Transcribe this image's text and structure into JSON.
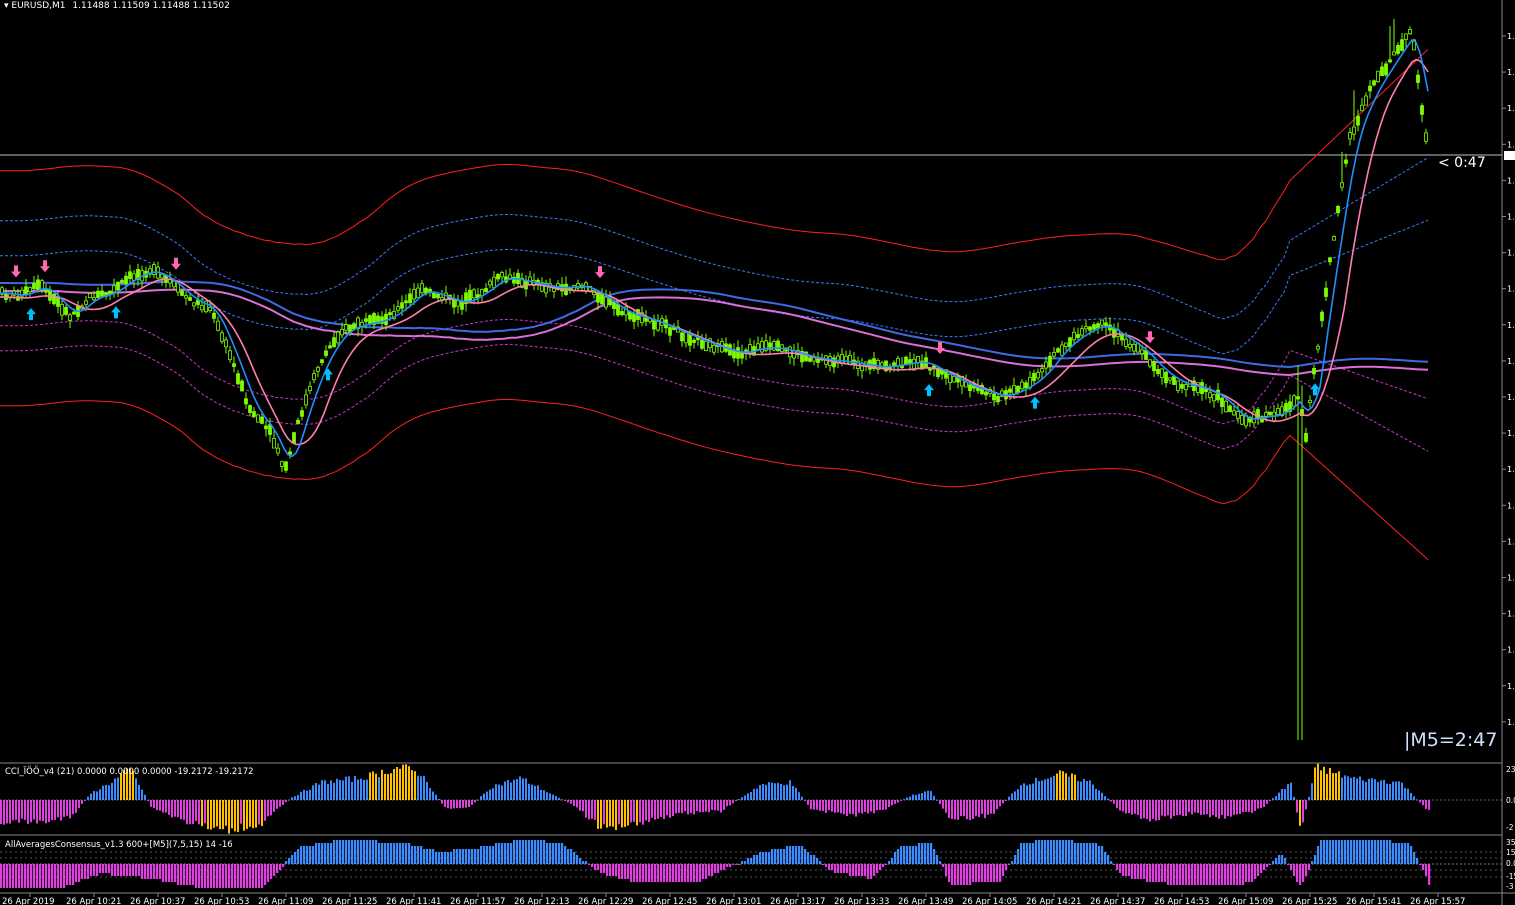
{
  "window": {
    "symbol_label": "EURUSD,M1",
    "ohlc_label": "1.11488 1.11509 1.11488 1.11502",
    "countdown": "< 0:47",
    "timer_m5": "|M5=2:47"
  },
  "indicators": {
    "cci_label": "CCI_ÏÖÖ_v4 (21) 0.0000 0.0000 0.0000 -19.2172 -19.2172",
    "cci_scale": [
      "23",
      "0.0",
      "-2"
    ],
    "consensus_label": "AllAveragesConsensus_v1.3 600+[M5](7,5,15) 14 -16",
    "consensus_scale": [
      "35",
      "15",
      "0.0",
      "-15",
      "-3"
    ]
  },
  "colors": {
    "background": "#000000",
    "candle": "#7CFC00",
    "ma_fast": "#1E90FF",
    "ma_slow": "#FF7FAF",
    "ma_long_blue": "#4169E1",
    "ma_long_magenta": "#DA70D6",
    "band_outer": "#FF2020",
    "band_inner": "#3A7CFF",
    "band_inner_low": "#CC33CC",
    "arrow_up": "#00BFFF",
    "arrow_down": "#FF69B4",
    "hist_blue": "#3C8CFF",
    "hist_magenta": "#E040E0",
    "hist_gold": "#FFC000"
  },
  "chart_data": {
    "type": "candlestick",
    "symbol": "EURUSD",
    "timeframe": "M1",
    "x_tick_labels": [
      "26 Apr 2019",
      "26 Apr 10:21",
      "26 Apr 10:37",
      "26 Apr 10:53",
      "26 Apr 11:09",
      "26 Apr 11:25",
      "26 Apr 11:41",
      "26 Apr 11:57",
      "26 Apr 12:13",
      "26 Apr 12:29",
      "26 Apr 12:45",
      "26 Apr 13:01",
      "26 Apr 13:17",
      "26 Apr 13:33",
      "26 Apr 13:49",
      "26 Apr 14:05",
      "26 Apr 14:21",
      "26 Apr 14:37",
      "26 Apr 14:53",
      "26 Apr 15:09",
      "26 Apr 15:25",
      "26 Apr 15:41",
      "26 Apr 15:57"
    ],
    "y_tick_labels": [
      "1.",
      "1.",
      "1.",
      "1.",
      "1.",
      "1.",
      "1.",
      "1.",
      "1.",
      "1.",
      "1.",
      "1.",
      "1.",
      "1.",
      "1.",
      "1.",
      "1.",
      "1.",
      "1.",
      "1."
    ],
    "price_path": [
      [
        0,
        60
      ],
      [
        20,
        62
      ],
      [
        40,
        55
      ],
      [
        60,
        68
      ],
      [
        70,
        75
      ],
      [
        90,
        63
      ],
      [
        110,
        60
      ],
      [
        130,
        50
      ],
      [
        150,
        45
      ],
      [
        170,
        53
      ],
      [
        190,
        65
      ],
      [
        210,
        70
      ],
      [
        230,
        100
      ],
      [
        250,
        135
      ],
      [
        270,
        150
      ],
      [
        285,
        175
      ],
      [
        300,
        140
      ],
      [
        320,
        105
      ],
      [
        340,
        85
      ],
      [
        360,
        80
      ],
      [
        380,
        78
      ],
      [
        400,
        70
      ],
      [
        420,
        58
      ],
      [
        440,
        62
      ],
      [
        460,
        67
      ],
      [
        480,
        60
      ],
      [
        500,
        50
      ],
      [
        520,
        52
      ],
      [
        540,
        55
      ],
      [
        560,
        57
      ],
      [
        580,
        55
      ],
      [
        600,
        62
      ],
      [
        620,
        72
      ],
      [
        640,
        76
      ],
      [
        660,
        80
      ],
      [
        680,
        86
      ],
      [
        700,
        91
      ],
      [
        720,
        96
      ],
      [
        740,
        99
      ],
      [
        760,
        95
      ],
      [
        780,
        96
      ],
      [
        800,
        100
      ],
      [
        820,
        103
      ],
      [
        840,
        104
      ],
      [
        860,
        106
      ],
      [
        880,
        108
      ],
      [
        900,
        106
      ],
      [
        920,
        104
      ],
      [
        940,
        111
      ],
      [
        960,
        118
      ],
      [
        980,
        123
      ],
      [
        1000,
        127
      ],
      [
        1020,
        122
      ],
      [
        1040,
        113
      ],
      [
        1060,
        96
      ],
      [
        1080,
        86
      ],
      [
        1100,
        80
      ],
      [
        1120,
        88
      ],
      [
        1140,
        97
      ],
      [
        1160,
        111
      ],
      [
        1180,
        119
      ],
      [
        1200,
        121
      ],
      [
        1220,
        128
      ],
      [
        1240,
        142
      ],
      [
        1260,
        140
      ],
      [
        1280,
        138
      ],
      [
        1300,
        125
      ],
      [
        1305,
        160
      ],
      [
        1312,
        120
      ],
      [
        1330,
        40
      ],
      [
        1350,
        -40
      ],
      [
        1370,
        -70
      ],
      [
        1390,
        -90
      ],
      [
        1400,
        -100
      ],
      [
        1412,
        -110
      ],
      [
        1425,
        -40
      ]
    ],
    "spike_low_at": 1300,
    "signals_up": [
      31,
      116,
      328,
      929,
      1035,
      1315
    ],
    "signals_down": [
      16,
      45,
      176,
      600,
      940,
      1150
    ],
    "cci_hist": [
      [
        0,
        -1
      ],
      [
        40,
        -1
      ],
      [
        70,
        -0.8
      ],
      [
        90,
        0.3
      ],
      [
        110,
        0.8
      ],
      [
        130,
        1.4
      ],
      [
        150,
        -0.3
      ],
      [
        180,
        -0.9
      ],
      [
        220,
        -1.4
      ],
      [
        260,
        -1.1
      ],
      [
        290,
        0.1
      ],
      [
        320,
        0.8
      ],
      [
        360,
        1.0
      ],
      [
        400,
        1.5
      ],
      [
        420,
        1.2
      ],
      [
        445,
        -0.4
      ],
      [
        470,
        -0.3
      ],
      [
        490,
        0.6
      ],
      [
        520,
        1.0
      ],
      [
        545,
        0.4
      ],
      [
        575,
        -0.3
      ],
      [
        600,
        -1.3
      ],
      [
        640,
        -1.0
      ],
      [
        680,
        -0.6
      ],
      [
        720,
        -0.5
      ],
      [
        760,
        0.7
      ],
      [
        790,
        0.8
      ],
      [
        810,
        -0.4
      ],
      [
        850,
        -0.7
      ],
      [
        880,
        -0.5
      ],
      [
        910,
        0.2
      ],
      [
        930,
        0.4
      ],
      [
        950,
        -0.9
      ],
      [
        990,
        -0.7
      ],
      [
        1020,
        0.7
      ],
      [
        1060,
        1.2
      ],
      [
        1090,
        0.8
      ],
      [
        1120,
        -0.5
      ],
      [
        1150,
        -0.9
      ],
      [
        1190,
        -0.6
      ],
      [
        1230,
        -0.8
      ],
      [
        1260,
        -0.4
      ],
      [
        1290,
        0.8
      ],
      [
        1300,
        -1.4
      ],
      [
        1315,
        1.5
      ],
      [
        1350,
        1.0
      ],
      [
        1400,
        0.8
      ],
      [
        1425,
        -0.4
      ]
    ],
    "consensus_hist": [
      [
        0,
        -1
      ],
      [
        60,
        -1
      ],
      [
        100,
        -0.4
      ],
      [
        150,
        -0.6
      ],
      [
        200,
        -1
      ],
      [
        260,
        -1
      ],
      [
        300,
        0.7
      ],
      [
        340,
        1
      ],
      [
        400,
        0.9
      ],
      [
        440,
        0.5
      ],
      [
        480,
        0.7
      ],
      [
        520,
        1
      ],
      [
        560,
        0.9
      ],
      [
        600,
        -0.4
      ],
      [
        640,
        -0.8
      ],
      [
        700,
        -0.7
      ],
      [
        760,
        0.5
      ],
      [
        800,
        0.8
      ],
      [
        830,
        -0.3
      ],
      [
        870,
        -0.6
      ],
      [
        900,
        0.7
      ],
      [
        930,
        0.9
      ],
      [
        950,
        -0.9
      ],
      [
        1000,
        -0.7
      ],
      [
        1020,
        0.9
      ],
      [
        1060,
        1
      ],
      [
        1100,
        0.8
      ],
      [
        1120,
        -0.5
      ],
      [
        1160,
        -0.8
      ],
      [
        1200,
        -0.9
      ],
      [
        1250,
        -0.8
      ],
      [
        1280,
        0.5
      ],
      [
        1300,
        -1
      ],
      [
        1320,
        1
      ],
      [
        1380,
        1
      ],
      [
        1410,
        0.8
      ],
      [
        1430,
        -1
      ]
    ]
  }
}
